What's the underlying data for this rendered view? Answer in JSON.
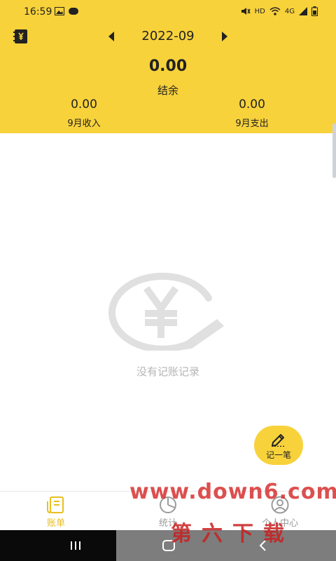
{
  "status_bar": {
    "time": "16:59",
    "network_label": "HD",
    "signal_label": "4G"
  },
  "header": {
    "month": "2022-09",
    "balance": {
      "amount": "0.00",
      "label": "结余"
    },
    "income": {
      "amount": "0.00",
      "label": "9月收入"
    },
    "expense": {
      "amount": "0.00",
      "label": "9月支出"
    }
  },
  "empty_state": {
    "text": "没有记账记录"
  },
  "fab": {
    "label": "记一笔"
  },
  "tabs": [
    {
      "label": "账单",
      "icon": "bill-icon",
      "active": true
    },
    {
      "label": "统计",
      "icon": "pie-chart-icon",
      "active": false
    },
    {
      "label": "个人中心",
      "icon": "user-icon",
      "active": false
    }
  ],
  "watermark": {
    "url": "www.down6.com",
    "text": "第六下载"
  },
  "colors": {
    "accent": "#f8d23b",
    "active_tab": "#e8bf1f",
    "inactive": "#9b9b9b",
    "placeholder": "#b5b5b5"
  }
}
